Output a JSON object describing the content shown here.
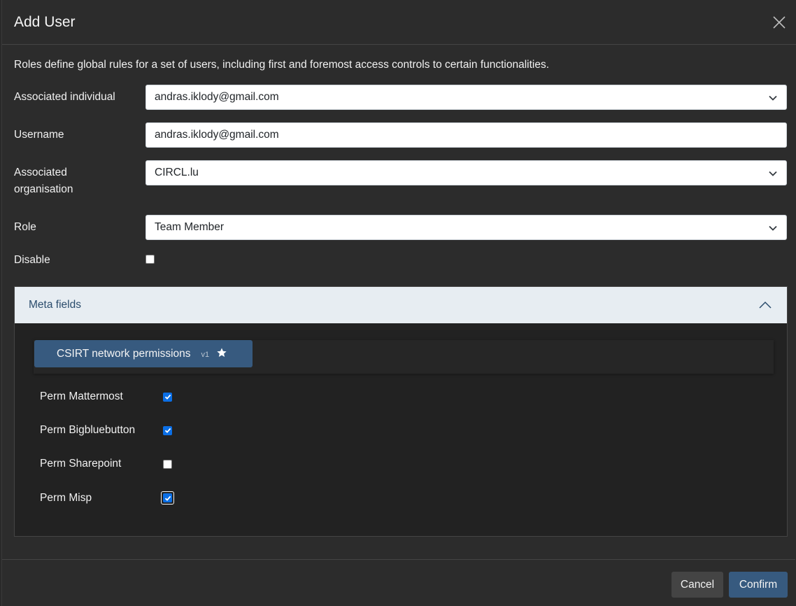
{
  "dialog": {
    "title": "Add User",
    "description": "Roles define global rules for a set of users, including first and foremost access controls to certain functionalities."
  },
  "form": {
    "associated_individual": {
      "label": "Associated individual",
      "value": "andras.iklody@gmail.com"
    },
    "username": {
      "label": "Username",
      "value": "andras.iklody@gmail.com"
    },
    "associated_organisation": {
      "label_line1": "Associated",
      "label_line2": "organisation",
      "value": "CIRCL.lu"
    },
    "role": {
      "label": "Role",
      "value": "Team Member"
    },
    "disable": {
      "label": "Disable",
      "checked": false
    }
  },
  "meta_fields": {
    "header": "Meta fields",
    "tab": {
      "label": "CSIRT network permissions",
      "version": "v1",
      "icon": "star-icon"
    },
    "permissions": [
      {
        "label": "Perm Mattermost",
        "checked": true
      },
      {
        "label": "Perm Bigbluebutton",
        "checked": true
      },
      {
        "label": "Perm Sharepoint",
        "checked": false
      },
      {
        "label": "Perm Misp",
        "checked": true,
        "focused": true
      }
    ]
  },
  "footer": {
    "cancel_label": "Cancel",
    "confirm_label": "Confirm"
  },
  "colors": {
    "primary": "#375a7f",
    "background": "#2c2c2c",
    "checkbox_checked": "#0b6fe6"
  }
}
